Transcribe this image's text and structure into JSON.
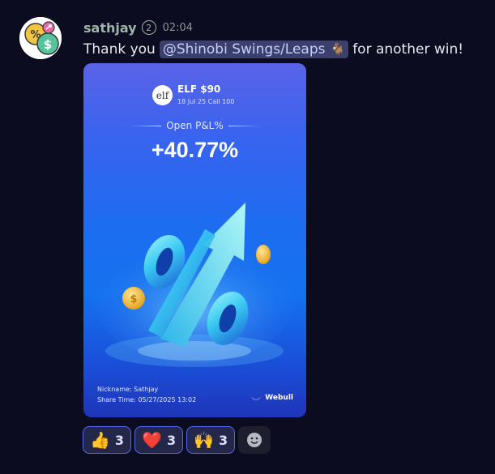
{
  "message": {
    "username": "sathjay",
    "role_badge": "2",
    "timestamp": "02:04",
    "text_before": "Thank you",
    "mention": "@Shinobi  Swings/Leaps",
    "mention_emoji": "🐐",
    "text_after": "for another win!"
  },
  "card": {
    "ticker": "ELF $90",
    "contract": "18 Jul 25 Call 100",
    "logo_text": "elf",
    "pl_label": "Open P&L%",
    "pl_value": "+40.77%",
    "nickname": "Nickname: Sathjay",
    "share_time": "Share Time: 05/27/2025 13:02",
    "brand": "Webull"
  },
  "reactions": [
    {
      "emoji": "👍",
      "count": "3",
      "name": "thumbs-up"
    },
    {
      "emoji": "❤️",
      "count": "3",
      "name": "heart"
    },
    {
      "emoji": "🙌",
      "count": "3",
      "name": "raised-hands"
    }
  ],
  "colors": {
    "background": "#0b0c1f",
    "username": "#9fb4a6",
    "mention_bg": "#3a3f6b",
    "reaction_border": "#5865f2"
  }
}
